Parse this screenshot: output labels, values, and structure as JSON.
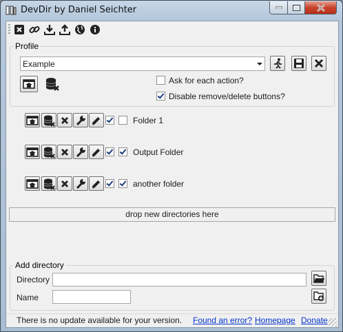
{
  "window": {
    "title": "DevDir by Daniel Seichter",
    "icons": {
      "app": "folder-tree-icon",
      "minimize": "minimize-icon",
      "maximize": "maximize-icon",
      "close": "close-icon"
    }
  },
  "toolbar": {
    "items": [
      {
        "icon": "close-x-icon"
      },
      {
        "icon": "link-icon"
      },
      {
        "icon": "download-icon"
      },
      {
        "icon": "upload-icon"
      },
      {
        "icon": "globe-icon"
      },
      {
        "icon": "info-icon"
      }
    ]
  },
  "profile": {
    "legend": "Profile",
    "selected": "Example",
    "ask_each_action_label": "Ask for each action?",
    "ask_each_action_checked": false,
    "disable_remove_label": "Disable remove/delete buttons?",
    "disable_remove_checked": true,
    "buttons": [
      "run-icon",
      "save-icon",
      "delete-icon",
      "open-folder-icon",
      "remove-database-icon"
    ]
  },
  "folders": [
    {
      "name": "Folder 1",
      "enabled": true,
      "checked": false
    },
    {
      "name": "Output Folder",
      "enabled": true,
      "checked": true
    },
    {
      "name": "another folder",
      "enabled": true,
      "checked": true
    }
  ],
  "drop_zone": {
    "text": "drop new directories here"
  },
  "add_directory": {
    "legend": "Add directory",
    "directory_label": "Directory",
    "directory_value": "",
    "name_label": "Name",
    "name_value": ""
  },
  "status": {
    "message": "There is no update available for your version.",
    "links": [
      "Found an error?",
      "Homepage",
      "Donate"
    ]
  },
  "colors": {
    "accent": "#0033cc",
    "close_button": "#c7432b",
    "checkmark": "#1c3a7a"
  }
}
